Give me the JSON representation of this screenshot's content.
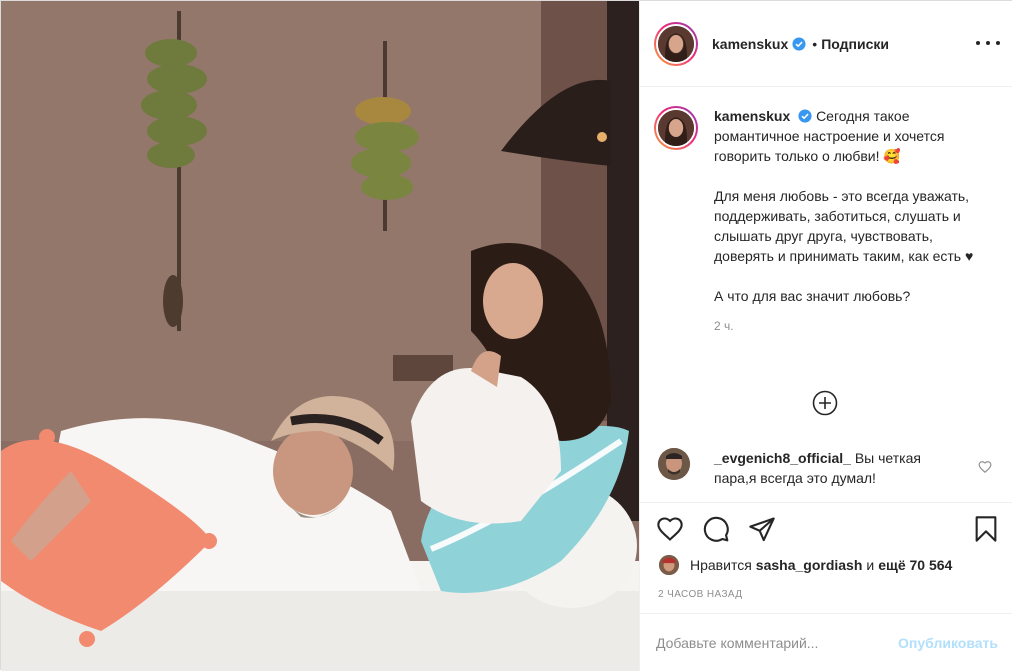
{
  "post": {
    "username": "kamenskux",
    "follow_separator": "•",
    "follow_label": "Подписки",
    "photo_alt": "Photo of a man in a straw hat and a curly-haired woman on a white sofa",
    "caption": {
      "username": "kamenskux",
      "line1": "Сегодня такое романтичное настроение и хочется говорить только о любви! 🥰",
      "line2": "Для меня любовь - это всегда уважать, поддерживать, заботиться, слушать и слышать друг друга, чувствовать, доверять и принимать таким, как есть ♥",
      "line3": "А что для вас значит любовь?",
      "time": "2 ч."
    },
    "comment": {
      "username": "_evgenich8_official_",
      "text": "Вы четкая пара,я всегда это думал!"
    },
    "likes": {
      "prefix": "Нравится",
      "user": "sasha_gordiash",
      "joiner": "и",
      "rest": "ещё 70 564"
    },
    "age": "2 часов назад",
    "add_comment": {
      "placeholder": "Добавьте комментарий...",
      "publish": "Опубликовать"
    }
  },
  "colors": {
    "verified": "#3897f0",
    "publish_disabled": "#b2dffc",
    "muted": "#8e8e8e"
  },
  "icons": [
    "more-icon",
    "verified-icon",
    "add-comments-icon",
    "heart-icon",
    "comment-icon",
    "share-icon",
    "bookmark-icon"
  ]
}
